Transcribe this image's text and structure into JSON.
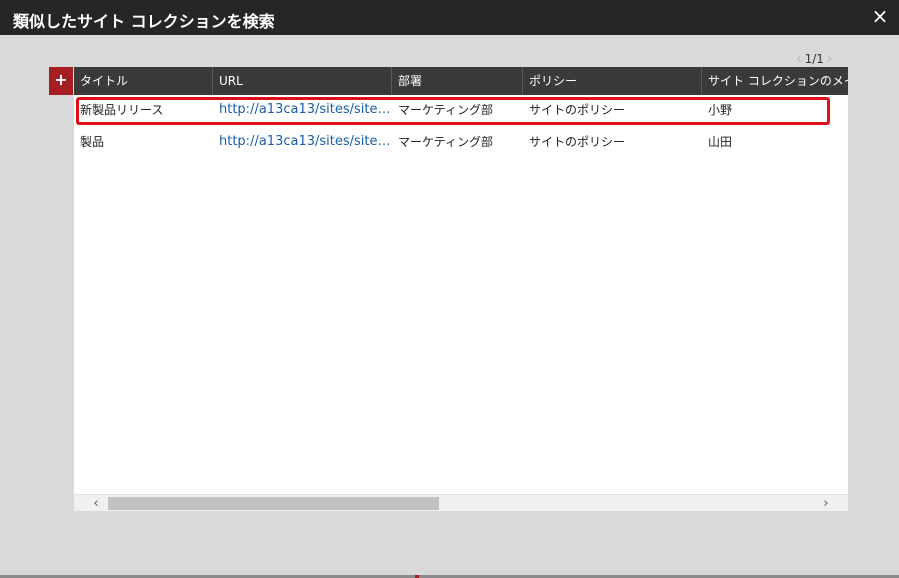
{
  "dialog": {
    "title": "類似したサイト コレクションを検索",
    "close_icon": "×"
  },
  "pager": {
    "prev_icon": "‹",
    "text": "1/1",
    "next_icon": "›"
  },
  "grid": {
    "add_icon": "+",
    "columns": [
      "タイトル",
      "URL",
      "部署",
      "ポリシー",
      "サイト コレクションのメイン"
    ],
    "rows": [
      [
        "新製品リリース",
        "http://a13ca13/sites/site…",
        "マーケティング部",
        "サイトのポリシー",
        "小野"
      ],
      [
        "製品",
        "http://a13ca13/sites/site…",
        "マーケティング部",
        "サイトのポリシー",
        "山田"
      ]
    ],
    "selected_row": 0
  },
  "scrollbar": {
    "left_icon": "‹",
    "right_icon": "›"
  },
  "colors": {
    "titlebar": "#262626",
    "header": "#3a3a3a",
    "accent": "#a41e22",
    "highlight": "#e0101a",
    "link": "#1a5ea8"
  }
}
